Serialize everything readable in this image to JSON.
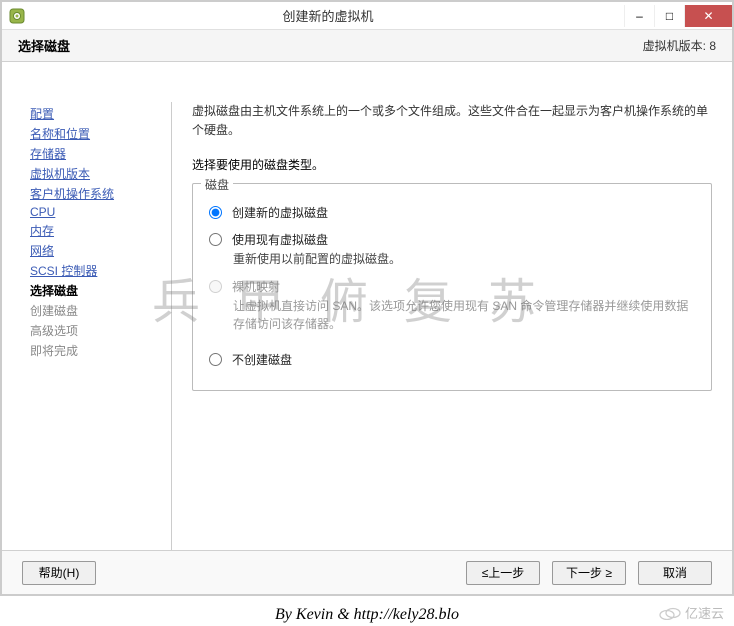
{
  "window": {
    "title": "创建新的虚拟机",
    "minimize": "–",
    "maximize": "□",
    "close": "✕"
  },
  "header": {
    "title": "选择磁盘",
    "version": "虚拟机版本: 8"
  },
  "sidebar": {
    "items": [
      {
        "label": "配置",
        "state": "link"
      },
      {
        "label": "名称和位置",
        "state": "link"
      },
      {
        "label": "存储器",
        "state": "link"
      },
      {
        "label": "虚拟机版本",
        "state": "link"
      },
      {
        "label": "客户机操作系统",
        "state": "link"
      },
      {
        "label": "CPU",
        "state": "link"
      },
      {
        "label": "内存",
        "state": "link"
      },
      {
        "label": "网络",
        "state": "link"
      },
      {
        "label": "SCSI 控制器",
        "state": "link"
      },
      {
        "label": "选择磁盘",
        "state": "current"
      },
      {
        "label": "创建磁盘",
        "state": "disabled"
      },
      {
        "label": "高级选项",
        "state": "disabled"
      },
      {
        "label": "即将完成",
        "state": "disabled"
      }
    ]
  },
  "content": {
    "description": "虚拟磁盘由主机文件系统上的一个或多个文件组成。这些文件合在一起显示为客户机操作系统的单个硬盘。",
    "prompt": "选择要使用的磁盘类型。",
    "group_label": "磁盘",
    "options": [
      {
        "label": "创建新的虚拟磁盘",
        "sub": "",
        "checked": true,
        "disabled": false
      },
      {
        "label": "使用现有虚拟磁盘",
        "sub": "重新使用以前配置的虚拟磁盘。",
        "checked": false,
        "disabled": false
      },
      {
        "label": "裸机映射",
        "sub": "让虚拟机直接访问 SAN。该选项允许您使用现有 SAN 命令管理存储器并继续使用数据存储访问该存储器。",
        "checked": false,
        "disabled": true
      },
      {
        "label": "不创建磁盘",
        "sub": "",
        "checked": false,
        "disabled": false
      }
    ]
  },
  "footer": {
    "help": "帮助(H)",
    "back": "≤上一步",
    "next": "下一步 ≥",
    "cancel": "取消"
  },
  "watermark": "兵甲俯复苏",
  "credit": "By Kevin & http://kely28.blo",
  "brand": "亿速云"
}
